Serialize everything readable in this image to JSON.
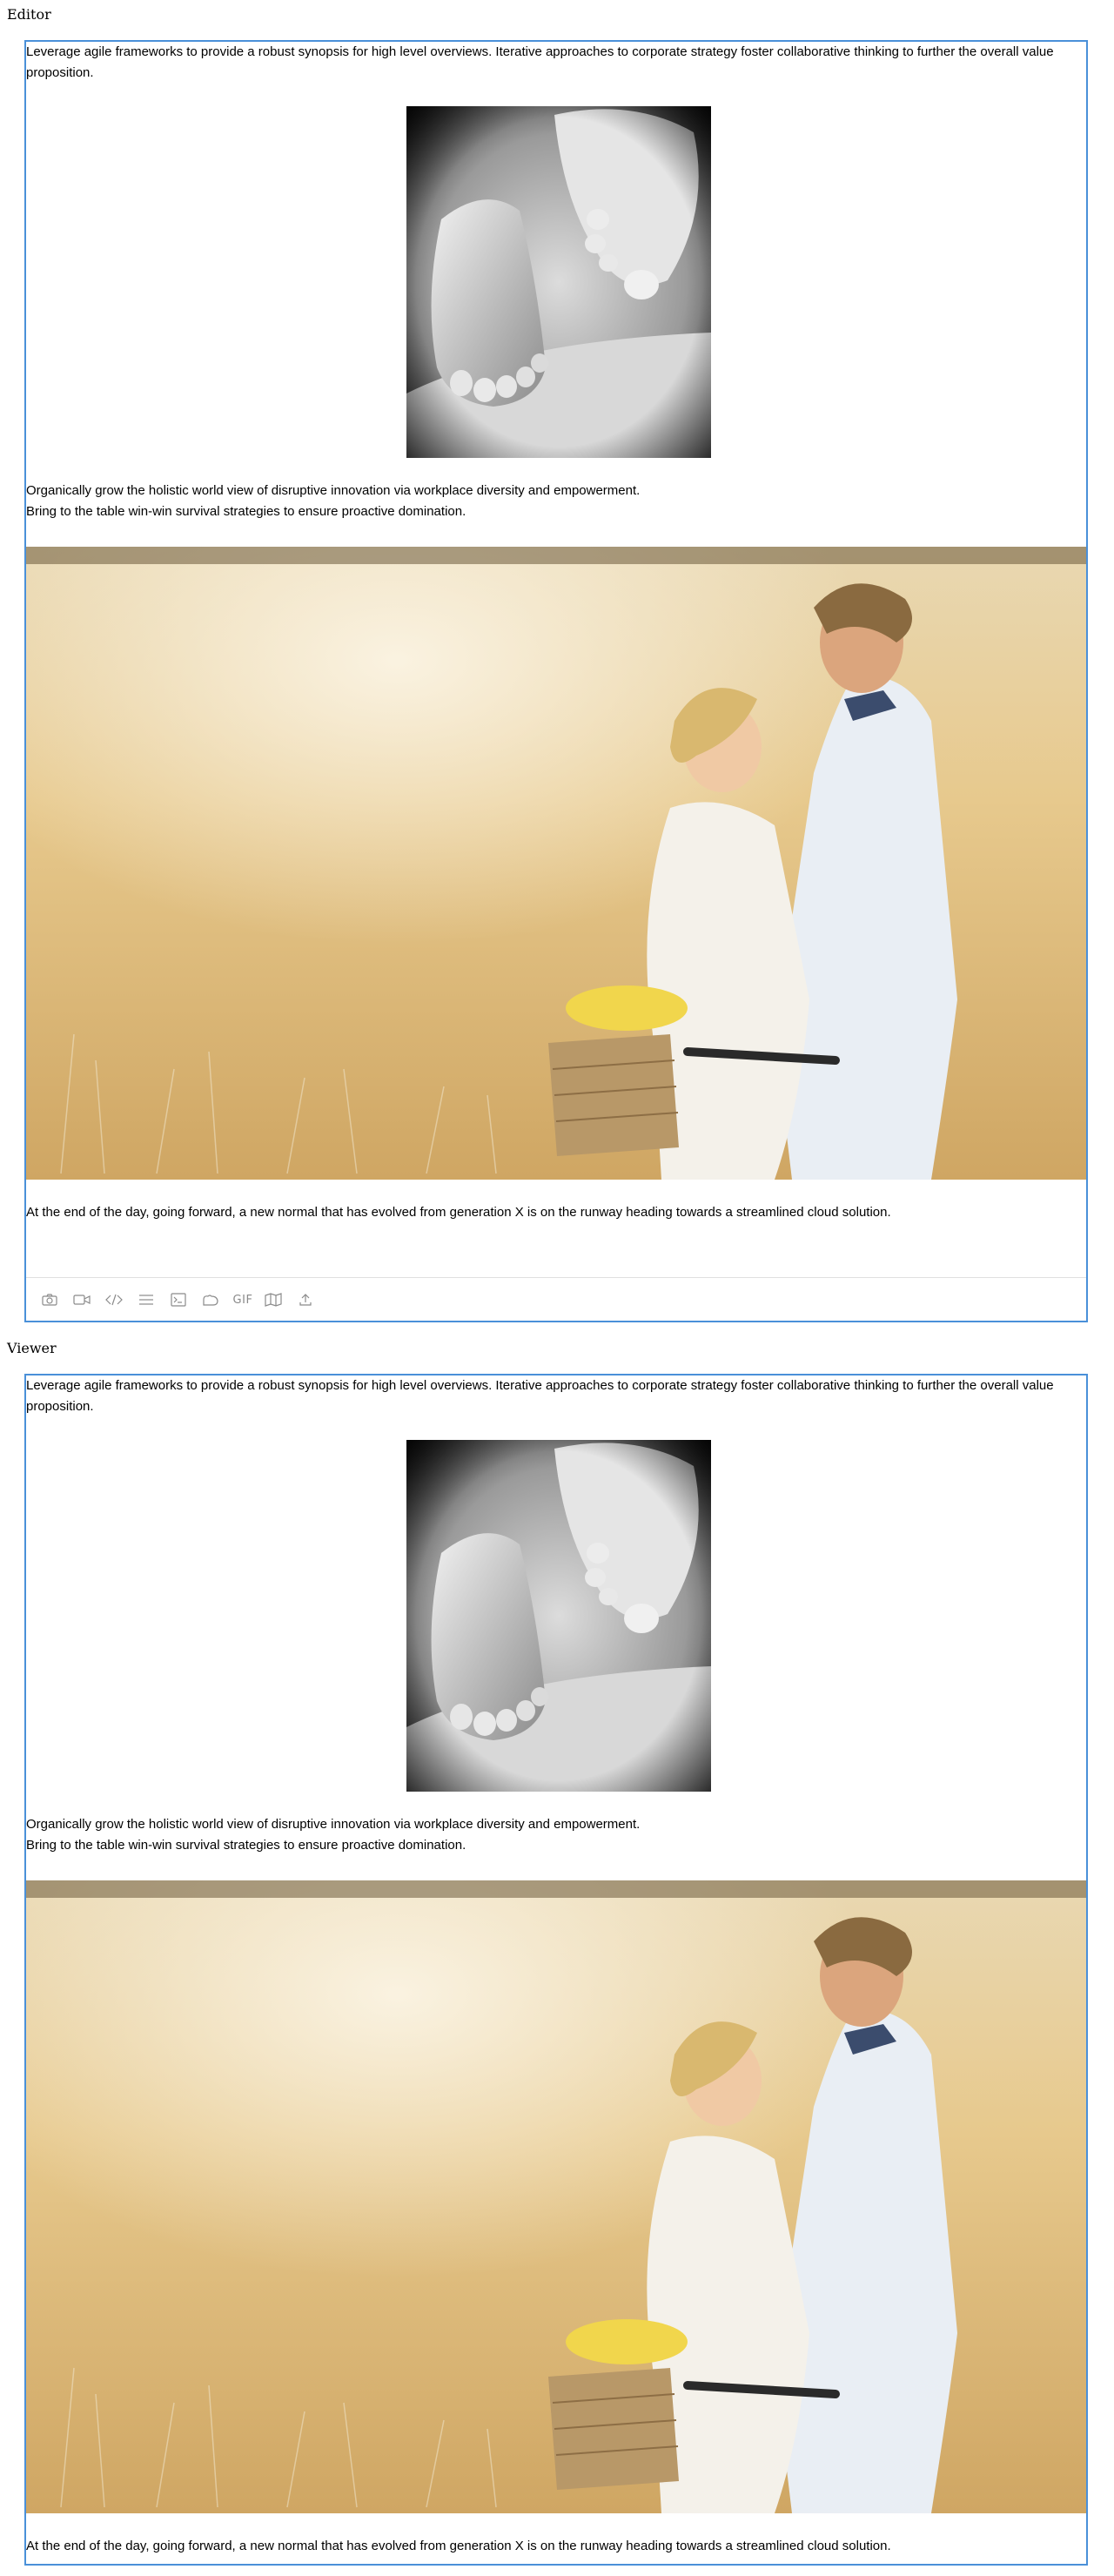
{
  "editor": {
    "label": "Editor",
    "paragraph_1": "Leverage agile frameworks to provide a robust synopsis for high level overviews. Iterative approaches to corporate strategy foster collaborative thinking to further the overall value proposition.",
    "paragraph_2_line_1": "Organically grow the holistic world view of disruptive innovation via workplace diversity and empowerment.",
    "paragraph_2_line_2": "Bring to the table win-win survival strategies to ensure proactive domination.",
    "paragraph_3": "At the end of the day, going forward, a new normal that has evolved from generation X is on the runway heading towards a streamlined cloud solution.",
    "toolbar": {
      "buttons": [
        {
          "icon": "camera-icon"
        },
        {
          "icon": "video-icon"
        },
        {
          "icon": "code-icon"
        },
        {
          "icon": "divider-icon"
        },
        {
          "icon": "html-icon"
        },
        {
          "icon": "giphy-icon"
        },
        {
          "icon": "gif-icon",
          "label": "GIF"
        },
        {
          "icon": "map-icon"
        },
        {
          "icon": "upload-icon"
        }
      ]
    }
  },
  "viewer": {
    "label": "Viewer",
    "paragraph_1": "Leverage agile frameworks to provide a robust synopsis for high level overviews. Iterative approaches to corporate strategy foster collaborative thinking to further the overall value proposition.",
    "paragraph_2_line_1": "Organically grow the holistic world view of disruptive innovation via workplace diversity and empowerment.",
    "paragraph_2_line_2": "Bring to the table win-win survival strategies to ensure proactive domination.",
    "paragraph_3": "At the end of the day, going forward, a new normal that has evolved from generation X is on the runway heading towards a streamlined cloud solution."
  },
  "colors": {
    "frame_border": "#4a90d9",
    "toolbar_icon": "#8a8a8a"
  }
}
